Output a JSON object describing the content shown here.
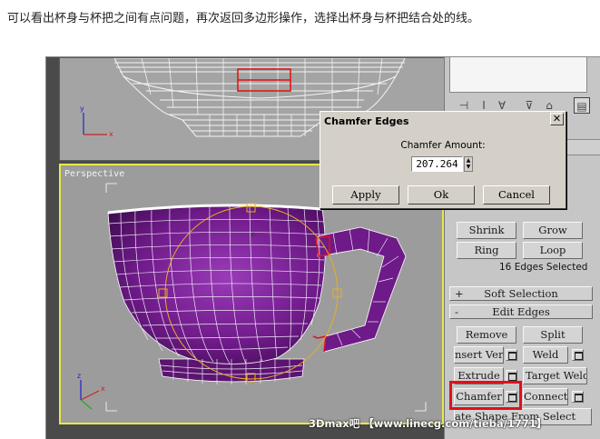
{
  "caption": "可以看出杯身与杯把之间有点问题，再次返回多边形操作，选择出杯身与杯把结合处的线。",
  "viewport": {
    "perspective_label": "Perspective"
  },
  "dialog": {
    "title": "Chamfer Edges",
    "close_label": "✕",
    "amount_label": "Chamfer Amount:",
    "amount_value": "207.264",
    "apply_label": "Apply",
    "ok_label": "Ok",
    "cancel_label": "Cancel"
  },
  "selection": {
    "shrink": "Shrink",
    "grow": "Grow",
    "ring": "Ring",
    "loop": "Loop",
    "status": "16 Edges Selected"
  },
  "rollouts": {
    "soft_selection_sign": "+",
    "soft_selection": "Soft Selection",
    "edit_edges_sign": "-",
    "edit_edges": "Edit Edges"
  },
  "edit_edges": {
    "remove": "Remove",
    "split": "Split",
    "insert_vertex": "nsert Verte",
    "weld": "Weld",
    "extrude": "Extrude",
    "target_weld": "Target Weld",
    "chamfer": "Chamfer",
    "connect": "Connect",
    "create_shape": "ate Shape From Select"
  },
  "watermark": "3Dmax吧 【www.linecg.com/tieba/1771】",
  "colors": {
    "viewport_border_active": "#e8e84a",
    "highlight": "#e0101a",
    "cup": "#6e1a88"
  }
}
